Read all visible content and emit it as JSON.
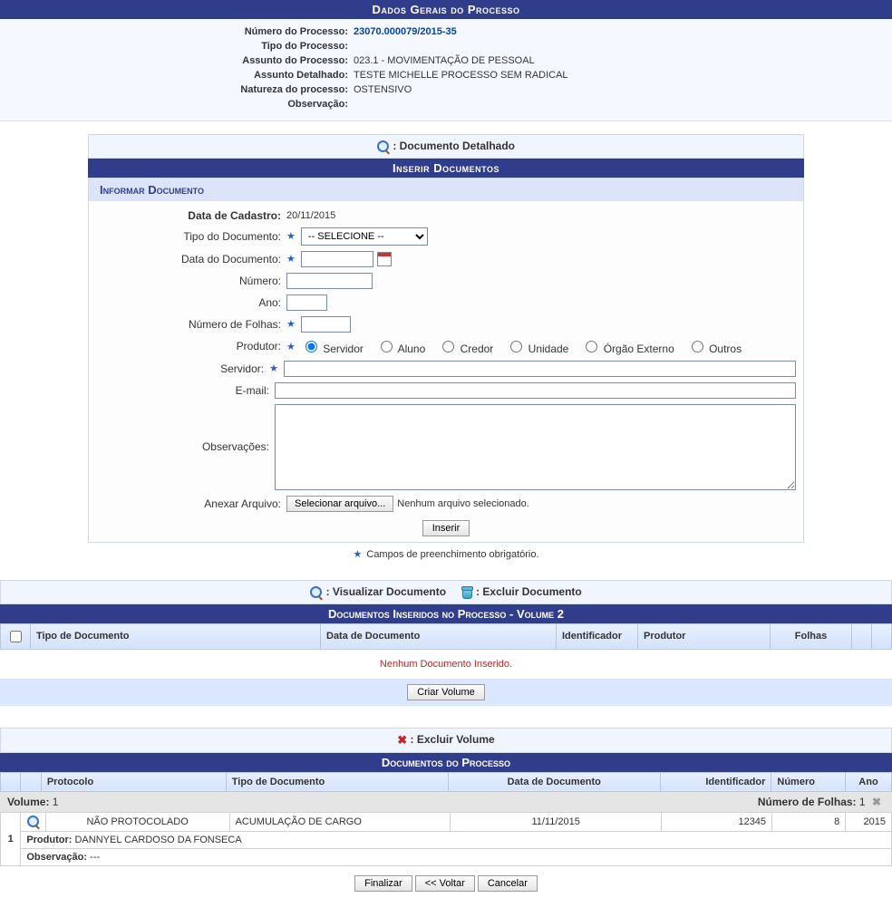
{
  "header": {
    "title": "Dados Gerais do Processo"
  },
  "process": {
    "numero_label": "Número do Processo:",
    "numero_value": "23070.000079/2015-35",
    "tipo_label": "Tipo do Processo:",
    "tipo_value": "",
    "assunto_label": "Assunto do Processo:",
    "assunto_value": "023.1 - MOVIMENTAÇÃO DE PESSOAL",
    "assunto_det_label": "Assunto Detalhado:",
    "assunto_det_value": "TESTE MICHELLE PROCESSO SEM RADICAL",
    "natureza_label": "Natureza do processo:",
    "natureza_value": "OSTENSIVO",
    "obs_label": "Observação:",
    "obs_value": ""
  },
  "legend1": {
    "text": ": Documento Detalhado"
  },
  "section_insert": "Inserir Documentos",
  "section_inform": "Informar Documento",
  "form": {
    "data_cad_label": "Data de Cadastro:",
    "data_cad_value": "20/11/2015",
    "tipo_doc_label": "Tipo do Documento:",
    "tipo_doc_selected": "-- SELECIONE --",
    "data_doc_label": "Data do Documento:",
    "data_doc_value": "",
    "numero_label": "Número:",
    "numero_value": "",
    "ano_label": "Ano:",
    "ano_value": "",
    "folhas_label": "Número de Folhas:",
    "folhas_value": "",
    "produtor_label": "Produtor:",
    "produtor_options": {
      "servidor": "Servidor",
      "aluno": "Aluno",
      "credor": "Credor",
      "unidade": "Unidade",
      "orgao": "Órgão Externo",
      "outros": "Outros"
    },
    "servidor_label": "Servidor:",
    "servidor_value": "",
    "email_label": "E-mail:",
    "email_value": "",
    "obs_label": "Observações:",
    "obs_value": "",
    "anexar_label": "Anexar Arquivo:",
    "file_btn": "Selecionar arquivo...",
    "file_none": "Nenhum arquivo selecionado.",
    "inserir_btn": "Inserir",
    "req_note": "Campos de preenchimento obrigatório."
  },
  "legend2": {
    "view": ": Visualizar Documento",
    "del": ": Excluir Documento"
  },
  "inserted": {
    "title": "Documentos Inseridos no Processo - Volume 2",
    "cols": {
      "tipo": "Tipo de Documento",
      "data": "Data de Documento",
      "ident": "Identificador",
      "prod": "Produtor",
      "folhas": "Folhas"
    },
    "empty": "Nenhum Documento Inserido.",
    "criar_btn": "Criar Volume"
  },
  "legend3": {
    "del_vol": ": Excluir Volume"
  },
  "docs_proc": {
    "title": "Documentos do Processo",
    "cols": {
      "protocolo": "Protocolo",
      "tipo": "Tipo de Documento",
      "data": "Data de Documento",
      "ident": "Identificador",
      "numero": "Número",
      "ano": "Ano"
    },
    "volume_label": "Volume:",
    "volume_value": "1",
    "folhas_label": "Número de Folhas:",
    "folhas_value": "1",
    "row": {
      "idx": "1",
      "protocolo": "NÃO PROTOCOLADO",
      "tipo": "ACUMULAÇÃO DE CARGO",
      "data": "11/11/2015",
      "ident": "12345",
      "numero": "8",
      "ano": "2015",
      "produtor_label": "Produtor:",
      "produtor_value": "DANNYEL CARDOSO DA FONSECA",
      "obs_label": "Observação:",
      "obs_value": "---"
    }
  },
  "footer": {
    "finalizar": "Finalizar",
    "voltar": "<< Voltar",
    "cancelar": "Cancelar"
  }
}
